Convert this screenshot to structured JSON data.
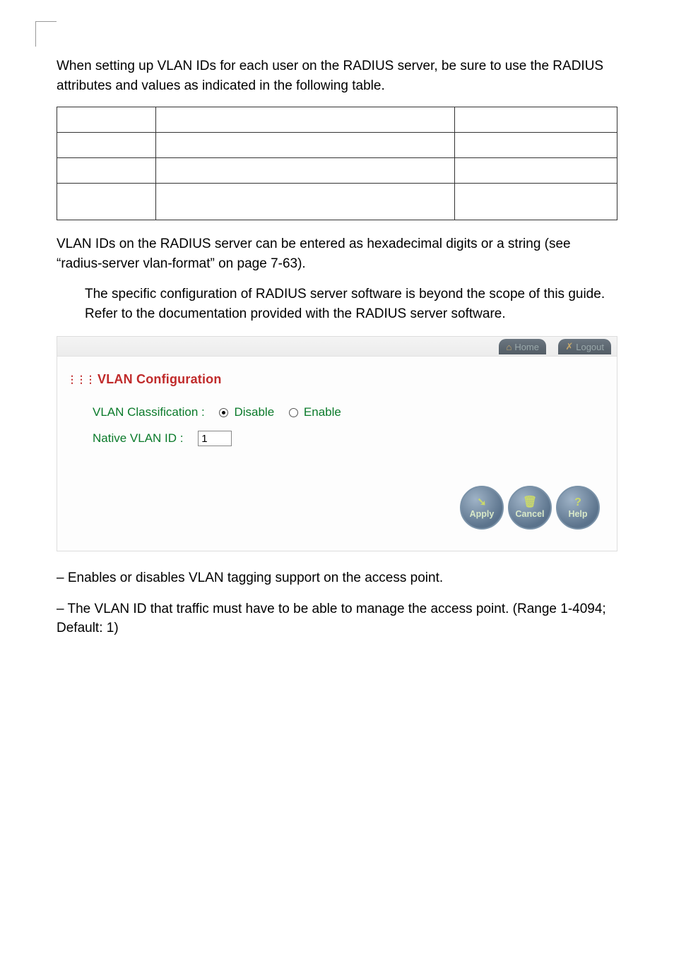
{
  "intro": "When setting up VLAN IDs for each user on the RADIUS server, be sure to use the RADIUS attributes and values as indicated in the following table.",
  "table": {
    "rows": [
      {
        "c1": "",
        "c2": "",
        "c3": ""
      },
      {
        "c1": "",
        "c2": "",
        "c3": ""
      },
      {
        "c1": "",
        "c2": "",
        "c3": ""
      },
      {
        "c1": "",
        "c2": "",
        "c3": ""
      }
    ]
  },
  "para2": "VLAN IDs on the RADIUS server can be entered as hexadecimal digits or a string (see “radius-server vlan-format” on page 7-63).",
  "note": "The specific configuration of RADIUS server software is beyond the scope of this guide. Refer to the documentation provided with the RADIUS server software.",
  "panel": {
    "tabs": {
      "home": "Home",
      "logout": "Logout"
    },
    "section_title": "VLAN Configuration",
    "form": {
      "classification_label": "VLAN Classification :",
      "disable_label": "Disable",
      "enable_label": "Enable",
      "selected": "disable",
      "native_label": "Native VLAN ID :",
      "native_value": "1"
    },
    "buttons": {
      "apply": "Apply",
      "cancel": "Cancel",
      "help": "Help"
    }
  },
  "desc_classification": " – Enables or disables VLAN tagging support on the access point.",
  "desc_native": " – The VLAN ID that traffic must have to be able to manage the access point. (Range 1-4094; Default: 1)"
}
